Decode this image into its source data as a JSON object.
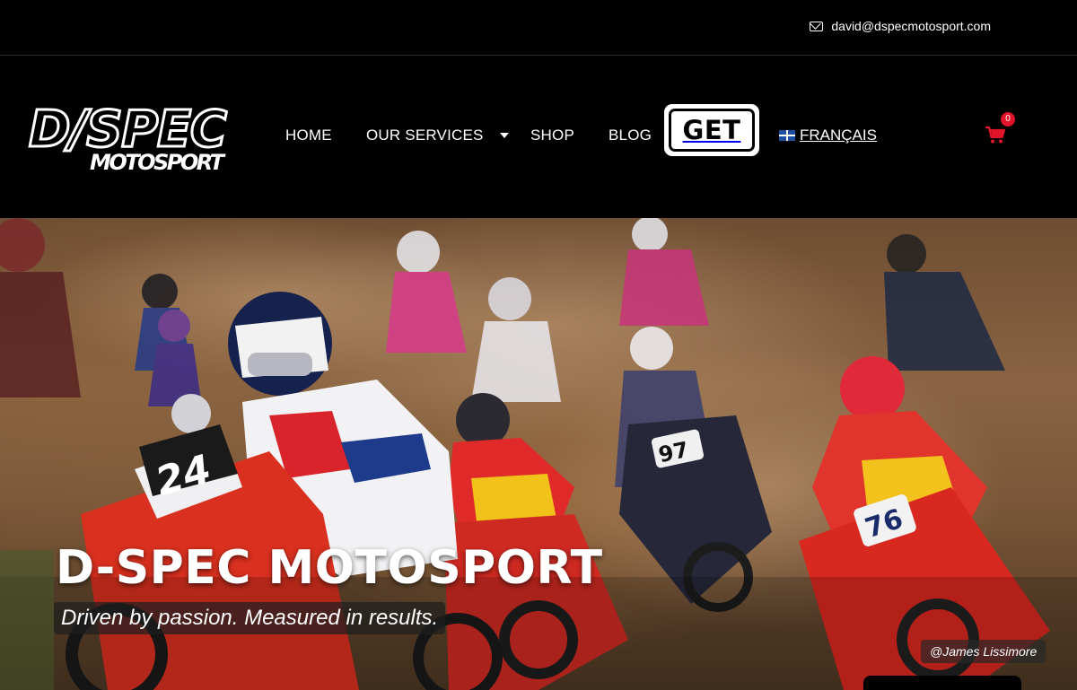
{
  "topbar": {
    "email": "david@dspecmotosport.com",
    "email_icon": "envelope-icon"
  },
  "logo": {
    "line1": "D/SPEC",
    "line2": "MOTOSPORT"
  },
  "nav": {
    "home": "HOME",
    "services": "OUR SERVICES",
    "shop": "SHOP",
    "blog": "BLOG",
    "get_button": "GET",
    "language": "FRANÇAIS",
    "language_flag": "quebec-flag-icon",
    "cart_icon": "cart-icon",
    "cart_count": "0"
  },
  "hero": {
    "title": "D-SPEC MOTOSPORT",
    "tagline": "Driven by passion. Measured in results.",
    "photo_credit": "@James Lissimore",
    "rider_numbers": [
      "24",
      "76",
      "97"
    ]
  },
  "colors": {
    "background": "#000000",
    "accent_red": "#e1142a",
    "text": "#ffffff"
  }
}
